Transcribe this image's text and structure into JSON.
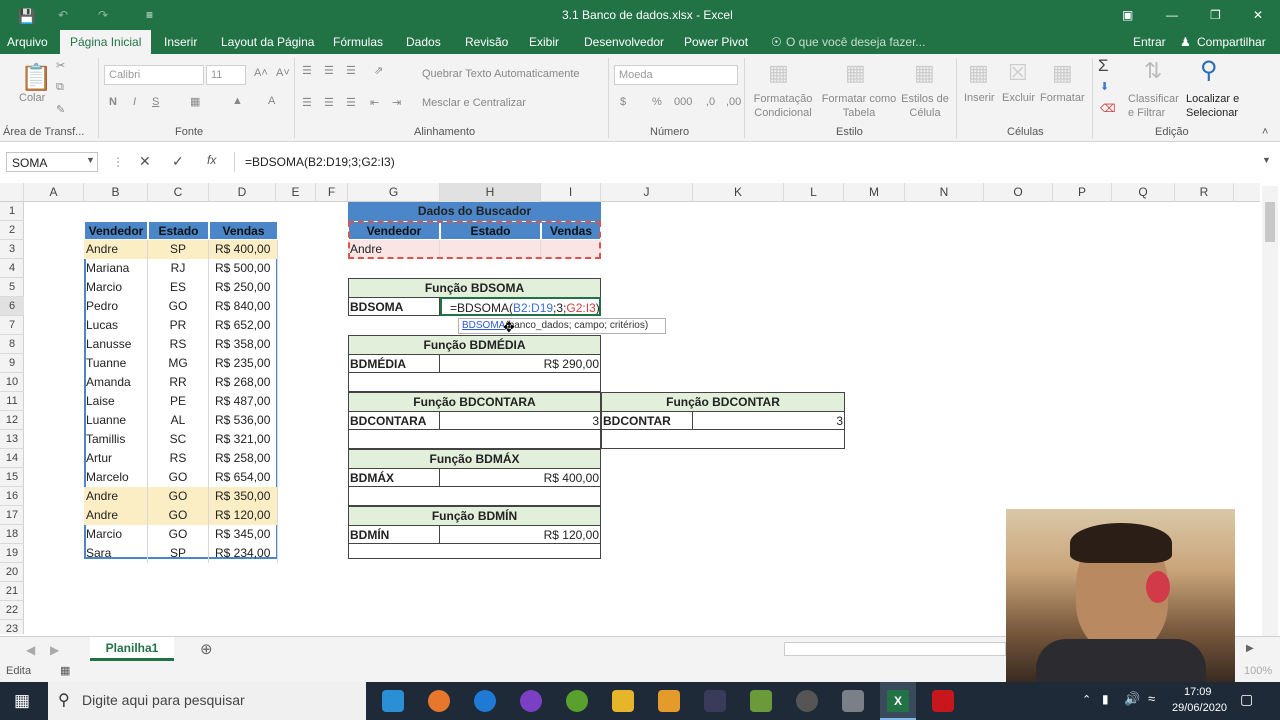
{
  "window": {
    "title": "3.1 Banco de dados.xlsx - Excel"
  },
  "ribbon_tabs": [
    "Arquivo",
    "Página Inicial",
    "Inserir",
    "Layout da Página",
    "Fórmulas",
    "Dados",
    "Revisão",
    "Exibir",
    "Desenvolvedor",
    "Power Pivot"
  ],
  "tell_me": "O que você deseja fazer...",
  "account": {
    "signin": "Entrar",
    "share": "Compartilhar"
  },
  "ribbon": {
    "paste": "Colar",
    "clipboard_label": "Área de Transf...",
    "font_name": "Calibri",
    "font_size": "11",
    "font_label": "Fonte",
    "wrap_text": "Quebrar Texto Automaticamente",
    "merge_center": "Mesclar e Centralizar",
    "alignment_label": "Alinhamento",
    "number_format": "Moeda",
    "number_label": "Número",
    "cond_format": "Formatação Condicional",
    "format_table": "Formatar como Tabela",
    "cell_styles": "Estilos de Célula",
    "styles_label": "Estilo",
    "insert": "Inserir",
    "delete": "Excluir",
    "format": "Formatar",
    "cells_label": "Células",
    "sort_filter": "Classificar e Filtrar",
    "find_select": "Localizar e Selecionar",
    "editing_label": "Edição"
  },
  "formula_bar": {
    "name_box": "SOMA",
    "formula": "=BDSOMA(B2:D19;3;G2:I3)"
  },
  "columns": [
    "A",
    "B",
    "C",
    "D",
    "E",
    "F",
    "G",
    "H",
    "I",
    "J",
    "K",
    "L",
    "M",
    "N",
    "O",
    "P",
    "Q",
    "R"
  ],
  "rows": [
    "1",
    "2",
    "3",
    "4",
    "5",
    "6",
    "7",
    "8",
    "9",
    "10",
    "11",
    "12",
    "13",
    "14",
    "15",
    "16",
    "17",
    "18",
    "19",
    "20",
    "21",
    "22",
    "23"
  ],
  "table": {
    "headers": [
      "Vendedor",
      "Estado",
      "Vendas"
    ],
    "rows": [
      [
        "Andre",
        "SP",
        "R$ 400,00"
      ],
      [
        "Mariana",
        "RJ",
        "R$ 500,00"
      ],
      [
        "Marcio",
        "ES",
        "R$ 250,00"
      ],
      [
        "Pedro",
        "GO",
        "R$ 840,00"
      ],
      [
        "Lucas",
        "PR",
        "R$ 652,00"
      ],
      [
        "Lanusse",
        "RS",
        "R$ 358,00"
      ],
      [
        "Tuanne",
        "MG",
        "R$ 235,00"
      ],
      [
        "Amanda",
        "RR",
        "R$ 268,00"
      ],
      [
        "Laise",
        "PE",
        "R$ 487,00"
      ],
      [
        "Luanne",
        "AL",
        "R$ 536,00"
      ],
      [
        "Tamillis",
        "SC",
        "R$ 321,00"
      ],
      [
        "Artur",
        "RS",
        "R$ 258,00"
      ],
      [
        "Marcelo",
        "GO",
        "R$ 654,00"
      ],
      [
        "Andre",
        "GO",
        "R$ 350,00"
      ],
      [
        "Andre",
        "GO",
        "R$ 120,00"
      ],
      [
        "Marcio",
        "GO",
        "R$ 345,00"
      ],
      [
        "Sara",
        "SP",
        "R$ 234,00"
      ]
    ]
  },
  "criteria": {
    "title": "Dados do Buscador",
    "headers": [
      "Vendedor",
      "Estado",
      "Vendas"
    ],
    "values": [
      "Andre",
      "",
      ""
    ]
  },
  "functions": {
    "bdsoma_title": "Função BDSOMA",
    "bdsoma_label": "BDSOMA",
    "bdsoma_edit_prefix": "=BDSOMA(",
    "bdsoma_edit_ref1": "B2:D19",
    "bdsoma_edit_mid": ";3;",
    "bdsoma_edit_ref2": "G2:I3",
    "bdsoma_edit_suffix": ")",
    "tooltip_func": "BDSOMA",
    "tooltip_args": "(banco_dados; campo; critérios)",
    "bdmedia_title": "Função BDMÉDIA",
    "bdmedia_label": "BDMÉDIA",
    "bdmedia_value": "R$ 290,00",
    "bdcontara_title": "Função BDCONTARA",
    "bdcontara_label": "BDCONTARA",
    "bdcontara_value": "3",
    "bdcontar_title": "Função BDCONTAR",
    "bdcontar_label": "BDCONTAR",
    "bdcontar_value": "3",
    "bdmax_title": "Função BDMÁX",
    "bdmax_label": "BDMÁX",
    "bdmax_value": "R$ 400,00",
    "bdmin_title": "Função BDMÍN",
    "bdmin_label": "BDMÍN",
    "bdmin_value": "R$ 120,00"
  },
  "sheet_tab": "Planilha1",
  "status": {
    "mode": "Edita",
    "zoom": "100%"
  },
  "taskbar": {
    "search": "Digite aqui para pesquisar",
    "time": "17:09",
    "date": "29/06/2020"
  },
  "colors": {
    "excel_green": "#217346",
    "header_blue": "#4a86c8",
    "stripe": "#fbeec5",
    "func_header": "#e2efda"
  }
}
